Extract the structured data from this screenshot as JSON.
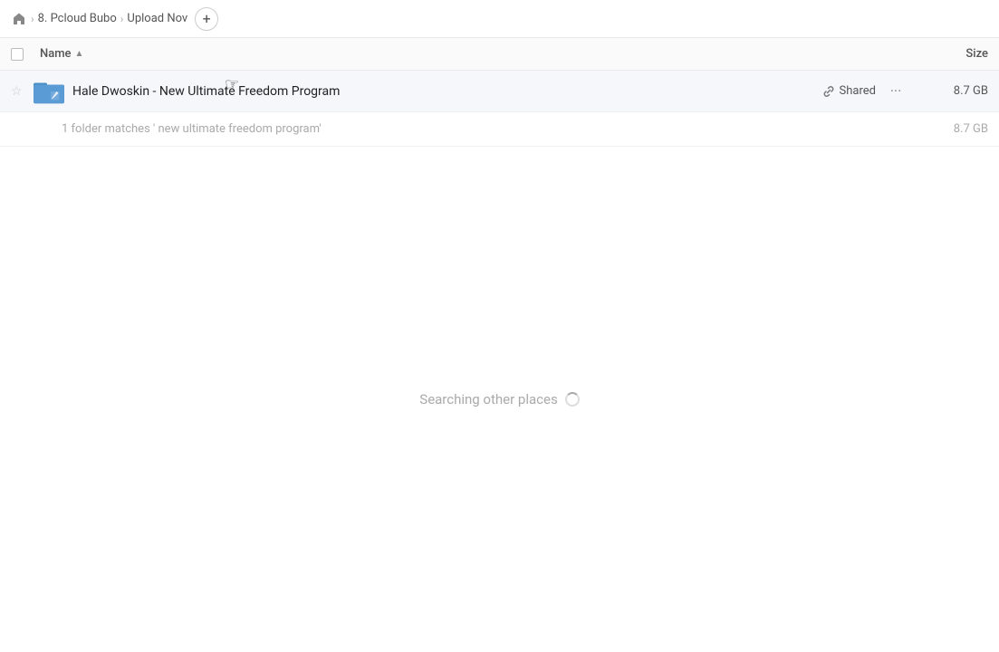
{
  "toolbar": {
    "home_label": "Home",
    "breadcrumb_1": "8. Pcloud Bubo",
    "breadcrumb_2": "Upload Nov",
    "add_button_label": "+"
  },
  "columns": {
    "name_label": "Name",
    "sort_indicator": "▲",
    "size_label": "Size"
  },
  "file_row": {
    "name": "Hale Dwoskin - New Ultimate Freedom Program",
    "shared_label": "Shared",
    "size": "8.7 GB",
    "more_label": "···"
  },
  "summary": {
    "text": "1 folder matches ' new ultimate freedom program'",
    "size": "8.7 GB"
  },
  "search_status": {
    "text": "Searching other places"
  }
}
